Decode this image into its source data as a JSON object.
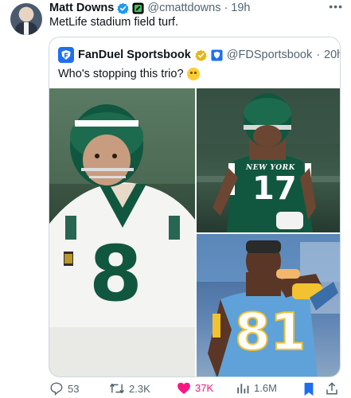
{
  "author": {
    "name": "Matt Downs",
    "handle": "@cmattdowns",
    "time": "19h",
    "text": "MetLife stadium field turf."
  },
  "quoted": {
    "name": "FanDuel Sportsbook",
    "handle": "@FDSportsbook",
    "time": "20h",
    "text": "Who's stopping this trio?"
  },
  "photos": {
    "left_number": "8",
    "top_right_number": "17",
    "top_right_text": "NEW YORK",
    "bottom_right_number": "81"
  },
  "actions": {
    "replies": "53",
    "retweets": "2.3K",
    "likes": "37K",
    "views": "1.6M"
  },
  "colors": {
    "jets_green": "#115740",
    "like_pink": "#f91880",
    "bookmark_blue": "#1d6ff2",
    "chargers_blue": "#5ea2d9",
    "chargers_gold": "#f2c230"
  }
}
